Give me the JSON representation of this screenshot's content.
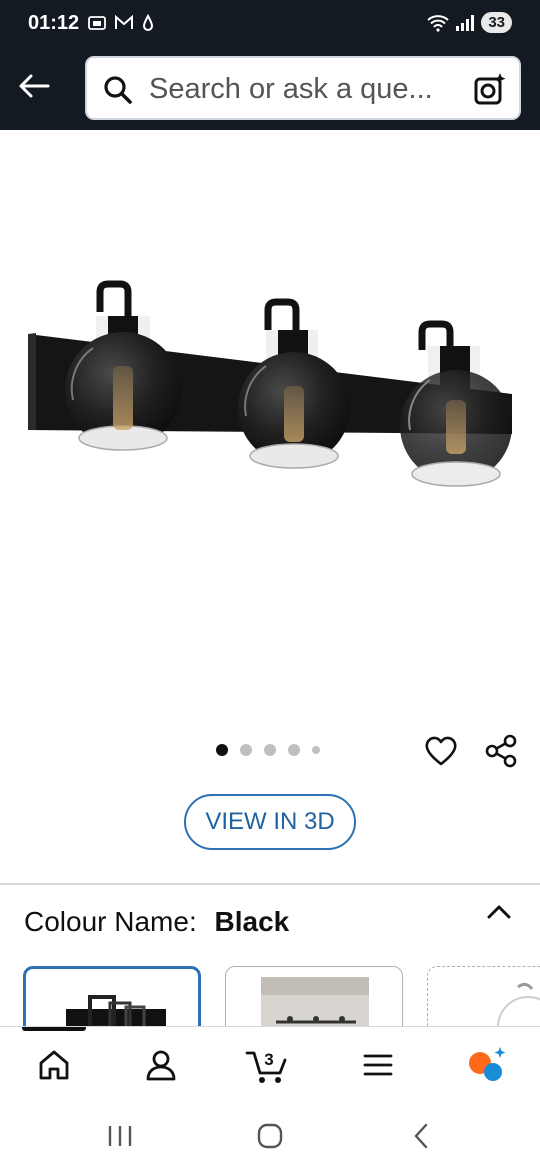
{
  "status_bar": {
    "time": "01:12",
    "battery": "33"
  },
  "search": {
    "placeholder": "Search or ask a que..."
  },
  "gallery": {
    "dot_count": 5,
    "active_index": 0
  },
  "view3d_label": "VIEW IN 3D",
  "colour": {
    "label": "Colour Name:",
    "value": "Black"
  },
  "cart": {
    "count": "3"
  },
  "colors": {
    "header_bg": "#131a22",
    "link_blue": "#2c71b3",
    "assist_orange": "#ff6a1a",
    "assist_blue": "#1a8bd6"
  },
  "icons": [
    "back-arrow-icon",
    "search-icon",
    "camera-lens-icon",
    "heart-icon",
    "share-icon",
    "chevron-up-icon",
    "home-icon",
    "user-icon",
    "cart-icon",
    "menu-icon",
    "rufus-assistant-icon"
  ]
}
